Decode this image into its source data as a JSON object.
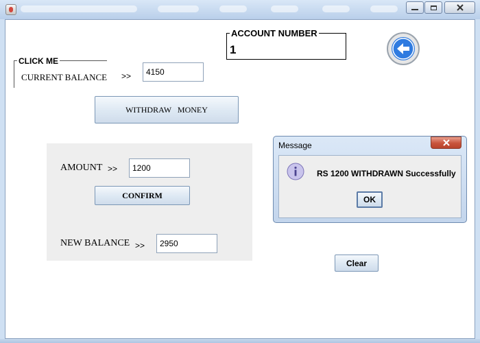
{
  "window": {
    "controls": {
      "minimize": "minimize",
      "maximize": "maximize",
      "close": "close"
    }
  },
  "account_box": {
    "label": "ACCOUNT NUMBER",
    "value": "1"
  },
  "click_me_group": {
    "label": "CLICK ME"
  },
  "current_balance": {
    "label": "CURRENT BALANCE",
    "arrow": ">>",
    "value": "4150"
  },
  "withdraw_button": {
    "label": "WITHDRAW   MONEY"
  },
  "amount": {
    "label": "AMOUNT",
    "arrow": ">>",
    "value": "1200"
  },
  "confirm_button": {
    "label": "CONFIRM"
  },
  "new_balance": {
    "label": "NEW BALANCE",
    "arrow": ">>",
    "value": "2950"
  },
  "clear_button": {
    "label": "Clear"
  },
  "back_button": {
    "icon": "back-arrow-icon"
  },
  "message_dialog": {
    "title": "Message",
    "text": "RS 1200 WITHDRAWN Successfully",
    "ok_label": "OK",
    "icon": "info-icon"
  },
  "colors": {
    "back_icon": "#2f7be0",
    "panel": "#eeeeee",
    "dialog_close": "#c8533b"
  }
}
